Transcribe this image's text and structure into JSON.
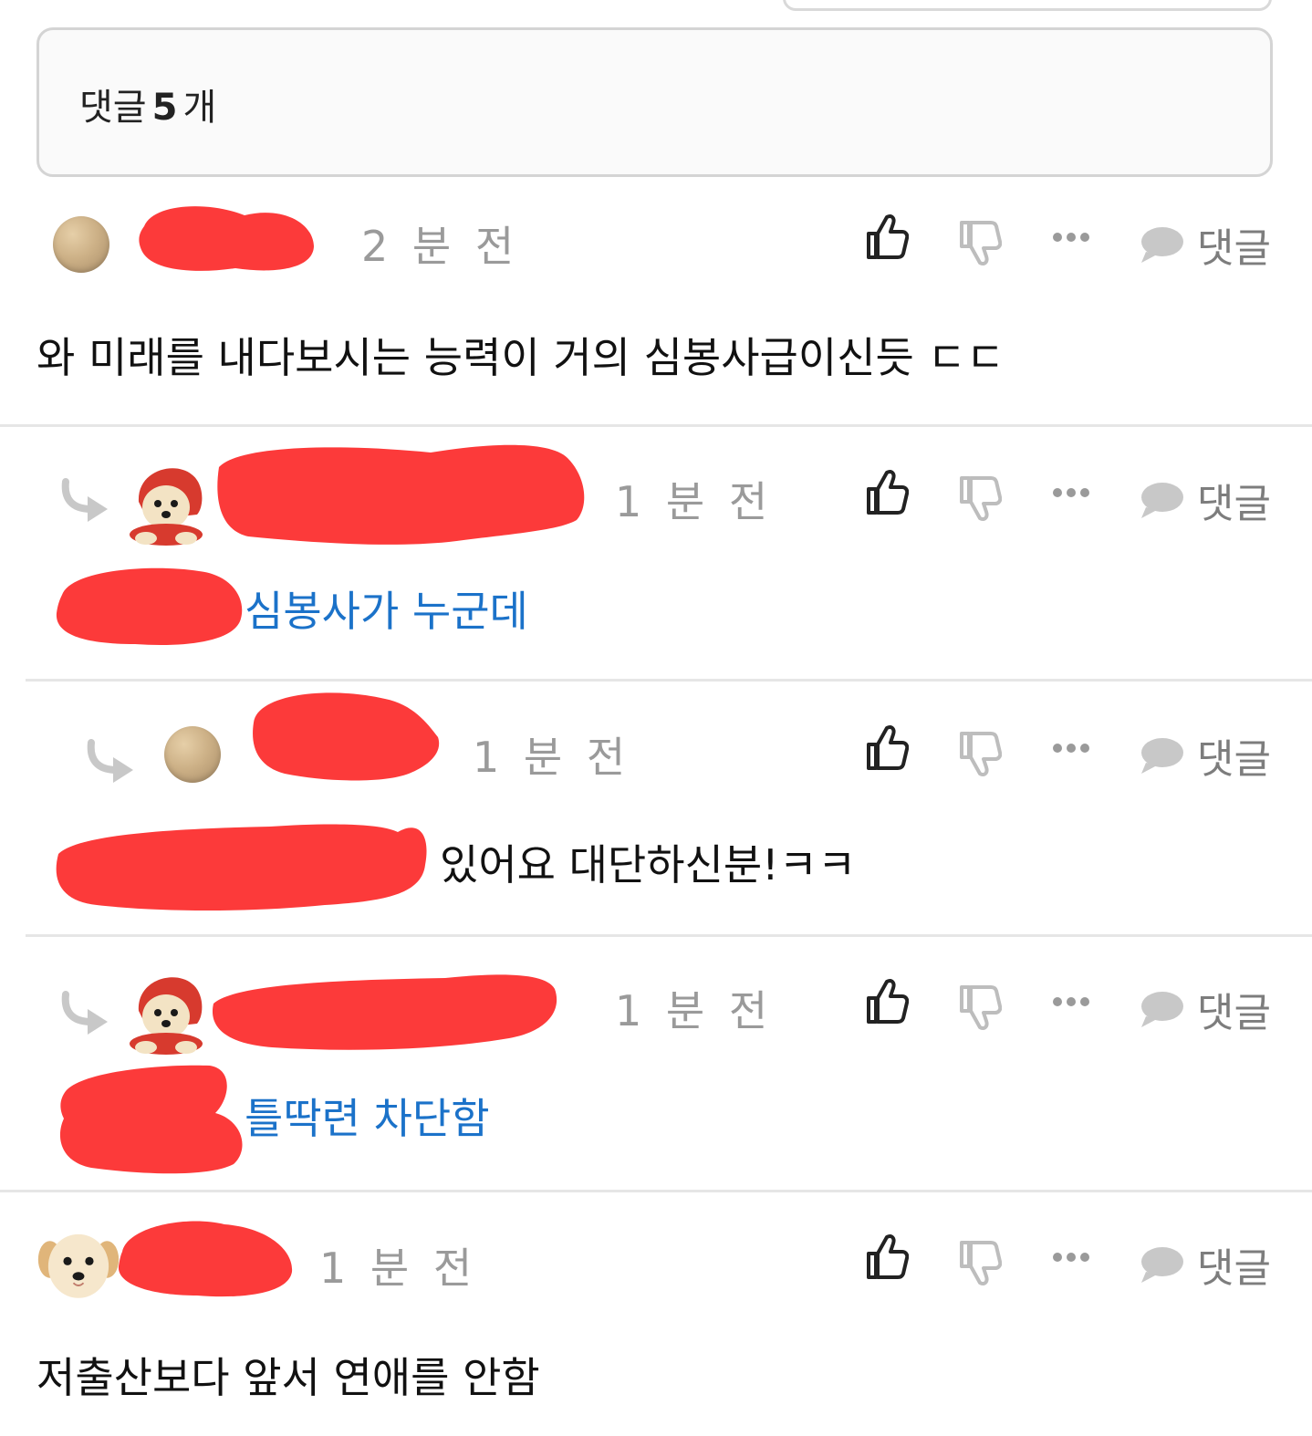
{
  "comment_header": {
    "label_prefix": "댓글",
    "count": "5",
    "label_suffix": "개"
  },
  "actions": {
    "reply_label": "댓글"
  },
  "comments": [
    {
      "time": "2 분 전",
      "text": "와 미래를 내다보시는 능력이 거의 심봉사급이신듯 ㄷㄷ",
      "is_reply": false
    },
    {
      "time": "1 분 전",
      "text": "심봉사가 누군데",
      "is_reply": true
    },
    {
      "time": "1 분 전",
      "text": "있어요 대단하신분!ㅋㅋ",
      "is_reply": true
    },
    {
      "time": "1 분 전",
      "text": "틀딱련 차단함",
      "is_reply": true
    },
    {
      "time": "1 분 전",
      "text": "저출산보다 앞서 연애를 안함",
      "is_reply": false
    }
  ],
  "colors": {
    "mention": "#1b72c9",
    "redaction": "#fc3a3a",
    "muted": "#9a9a9a"
  },
  "icons": [
    "thumbs-up-icon",
    "thumbs-down-icon",
    "more-icon",
    "speech-bubble-icon",
    "reply-arrow-icon"
  ]
}
